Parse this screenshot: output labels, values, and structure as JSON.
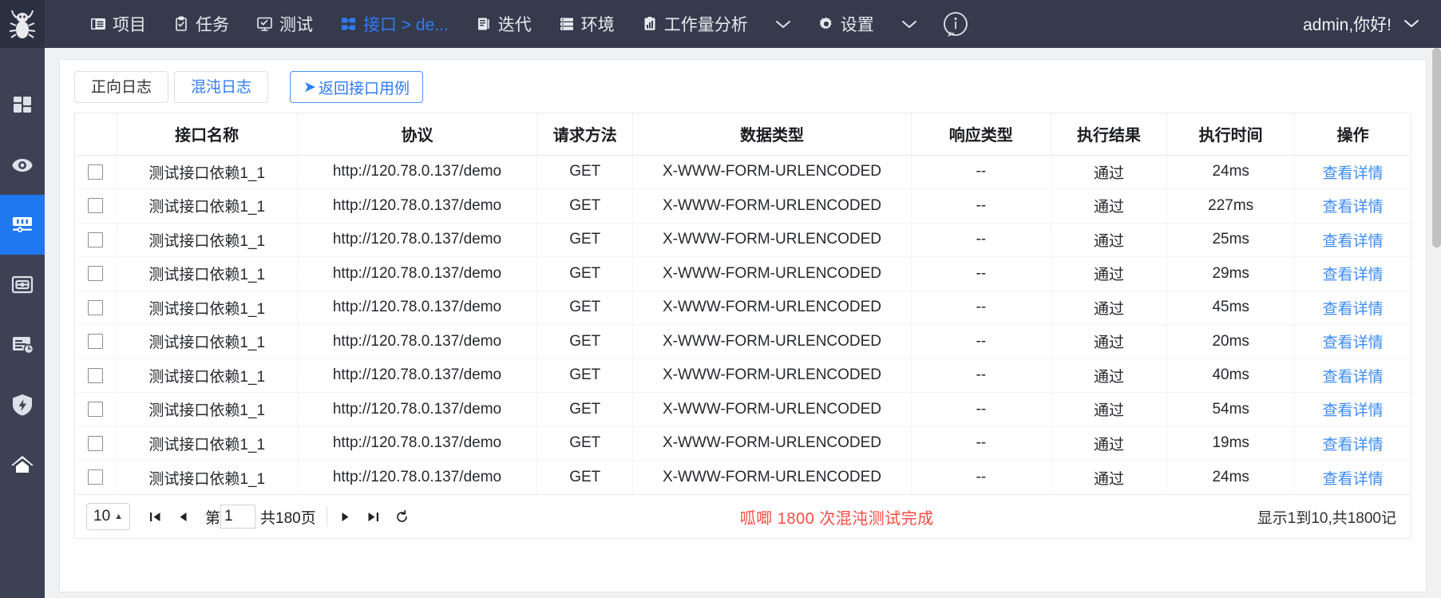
{
  "topnav": {
    "logo_icon": "bug-logo-icon",
    "items": [
      {
        "label": "项目",
        "icon": "project-icon",
        "active": false
      },
      {
        "label": "任务",
        "icon": "task-clipboard-icon",
        "active": false
      },
      {
        "label": "测试",
        "icon": "test-monitor-icon",
        "active": false
      },
      {
        "label": "接口 > de...",
        "icon": "interface-grid-icon",
        "active": true
      },
      {
        "label": "迭代",
        "icon": "iteration-book-icon",
        "active": false
      },
      {
        "label": "环境",
        "icon": "environment-server-icon",
        "active": false
      },
      {
        "label": "工作量分析",
        "icon": "workload-chart-icon",
        "active": false
      }
    ],
    "caret_after_workload": "chevron-down-icon",
    "settings": {
      "label": "设置",
      "icon": "gear-icon"
    },
    "caret_after_settings": "chevron-down-icon",
    "info_icon": "info-circle-icon",
    "user": {
      "label": "admin,你好!",
      "caret": "chevron-down-icon"
    }
  },
  "sidebar": {
    "items": [
      {
        "name": "dashboard",
        "icon": "dashboard-grid-icon",
        "active": false
      },
      {
        "name": "monitor",
        "icon": "eye-view-icon",
        "active": false
      },
      {
        "name": "interface-test",
        "icon": "sliders-config-icon",
        "active": true
      },
      {
        "name": "ui-test",
        "icon": "screen-box-icon",
        "active": false
      },
      {
        "name": "report",
        "icon": "report-clock-icon",
        "active": false
      },
      {
        "name": "chaos",
        "icon": "shield-bolt-icon",
        "active": false
      },
      {
        "name": "home",
        "icon": "home-icon",
        "active": false
      }
    ]
  },
  "tabs": {
    "items": [
      {
        "label": "正向日志",
        "active": true
      },
      {
        "label": "混沌日志",
        "active": false
      }
    ],
    "back_button": {
      "label": "返回接口用例",
      "icon": "arrow-right-icon"
    }
  },
  "table": {
    "headers": [
      "接口名称",
      "协议",
      "请求方法",
      "数据类型",
      "响应类型",
      "执行结果",
      "执行时间",
      "操作"
    ],
    "action_label": "查看详情",
    "rows": [
      {
        "name": "测试接口依赖1_1",
        "protocol": "http://120.78.0.137/demo",
        "method": "GET",
        "data_type": "X-WWW-FORM-URLENCODED",
        "resp_type": "--",
        "result": "通过",
        "time": "24ms"
      },
      {
        "name": "测试接口依赖1_1",
        "protocol": "http://120.78.0.137/demo",
        "method": "GET",
        "data_type": "X-WWW-FORM-URLENCODED",
        "resp_type": "--",
        "result": "通过",
        "time": "227ms"
      },
      {
        "name": "测试接口依赖1_1",
        "protocol": "http://120.78.0.137/demo",
        "method": "GET",
        "data_type": "X-WWW-FORM-URLENCODED",
        "resp_type": "--",
        "result": "通过",
        "time": "25ms"
      },
      {
        "name": "测试接口依赖1_1",
        "protocol": "http://120.78.0.137/demo",
        "method": "GET",
        "data_type": "X-WWW-FORM-URLENCODED",
        "resp_type": "--",
        "result": "通过",
        "time": "29ms"
      },
      {
        "name": "测试接口依赖1_1",
        "protocol": "http://120.78.0.137/demo",
        "method": "GET",
        "data_type": "X-WWW-FORM-URLENCODED",
        "resp_type": "--",
        "result": "通过",
        "time": "45ms"
      },
      {
        "name": "测试接口依赖1_1",
        "protocol": "http://120.78.0.137/demo",
        "method": "GET",
        "data_type": "X-WWW-FORM-URLENCODED",
        "resp_type": "--",
        "result": "通过",
        "time": "20ms"
      },
      {
        "name": "测试接口依赖1_1",
        "protocol": "http://120.78.0.137/demo",
        "method": "GET",
        "data_type": "X-WWW-FORM-URLENCODED",
        "resp_type": "--",
        "result": "通过",
        "time": "40ms"
      },
      {
        "name": "测试接口依赖1_1",
        "protocol": "http://120.78.0.137/demo",
        "method": "GET",
        "data_type": "X-WWW-FORM-URLENCODED",
        "resp_type": "--",
        "result": "通过",
        "time": "54ms"
      },
      {
        "name": "测试接口依赖1_1",
        "protocol": "http://120.78.0.137/demo",
        "method": "GET",
        "data_type": "X-WWW-FORM-URLENCODED",
        "resp_type": "--",
        "result": "通过",
        "time": "19ms"
      },
      {
        "name": "测试接口依赖1_1",
        "protocol": "http://120.78.0.137/demo",
        "method": "GET",
        "data_type": "X-WWW-FORM-URLENCODED",
        "resp_type": "--",
        "result": "通过",
        "time": "24ms"
      }
    ]
  },
  "pagination": {
    "page_size": "10",
    "first_icon": "first-page-icon",
    "prev_icon": "prev-page-icon",
    "page_prefix": "第",
    "page_value": "1",
    "total_pages": "共180页",
    "next_icon": "next-page-icon",
    "last_icon": "last-page-icon",
    "refresh_icon": "refresh-icon",
    "status_text": "呱唧  1800 次混沌测试完成",
    "status_color": "#fa4b42",
    "count_text": "显示1到10,共1800记"
  }
}
